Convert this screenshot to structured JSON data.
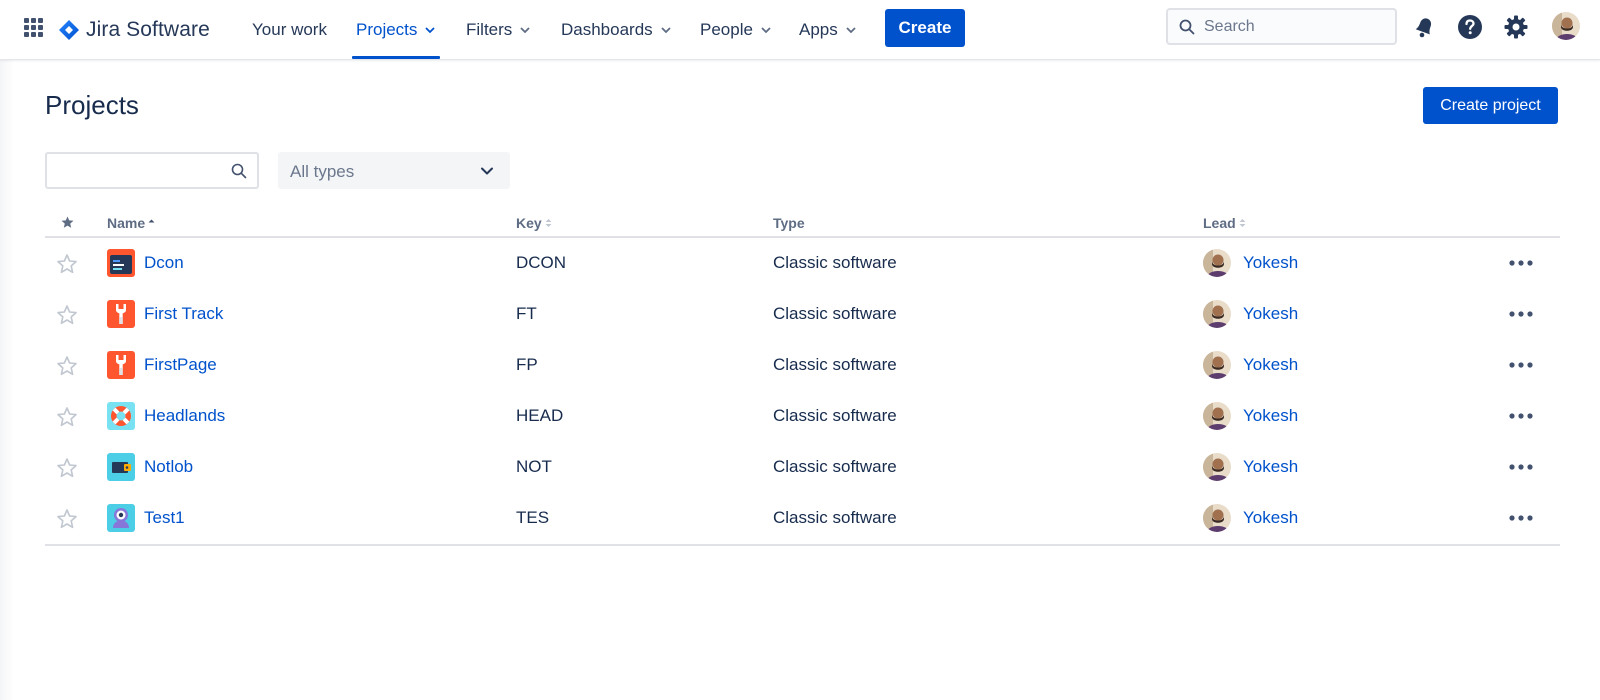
{
  "app": {
    "logo_text": "Jira Software"
  },
  "nav": {
    "items": [
      {
        "label": "Your work",
        "has_dropdown": false,
        "active": false
      },
      {
        "label": "Projects",
        "has_dropdown": true,
        "active": true
      },
      {
        "label": "Filters",
        "has_dropdown": true,
        "active": false
      },
      {
        "label": "Dashboards",
        "has_dropdown": true,
        "active": false
      },
      {
        "label": "People",
        "has_dropdown": true,
        "active": false
      },
      {
        "label": "Apps",
        "has_dropdown": true,
        "active": false
      }
    ],
    "create_label": "Create",
    "search_placeholder": "Search",
    "icons": [
      "notifications-icon",
      "help-icon",
      "settings-icon",
      "profile-avatar"
    ]
  },
  "page": {
    "title": "Projects",
    "create_project_label": "Create project",
    "filter": {
      "search_value": "",
      "type_selected": "All types"
    }
  },
  "table": {
    "columns": {
      "star": "starred-icon",
      "name": "Name",
      "key": "Key",
      "type": "Type",
      "lead": "Lead"
    },
    "rows": [
      {
        "name": "Dcon",
        "key": "DCON",
        "type": "Classic software",
        "lead": "Yokesh",
        "icon": "dcon-project-icon",
        "starred": false
      },
      {
        "name": "First Track",
        "key": "FT",
        "type": "Classic software",
        "lead": "Yokesh",
        "icon": "wrench-project-icon",
        "starred": false
      },
      {
        "name": "FirstPage",
        "key": "FP",
        "type": "Classic software",
        "lead": "Yokesh",
        "icon": "wrench-project-icon",
        "starred": false
      },
      {
        "name": "Headlands",
        "key": "HEAD",
        "type": "Classic software",
        "lead": "Yokesh",
        "icon": "lifebuoy-project-icon",
        "starred": false
      },
      {
        "name": "Notlob",
        "key": "NOT",
        "type": "Classic software",
        "lead": "Yokesh",
        "icon": "wallet-project-icon",
        "starred": false
      },
      {
        "name": "Test1",
        "key": "TES",
        "type": "Classic software",
        "lead": "Yokesh",
        "icon": "robot-project-icon",
        "starred": false
      }
    ]
  },
  "colors": {
    "brand_blue": "#0052cc",
    "text_dark": "#172b4d",
    "text_subtle": "#5e6c84",
    "border": "#dfe1e6"
  }
}
